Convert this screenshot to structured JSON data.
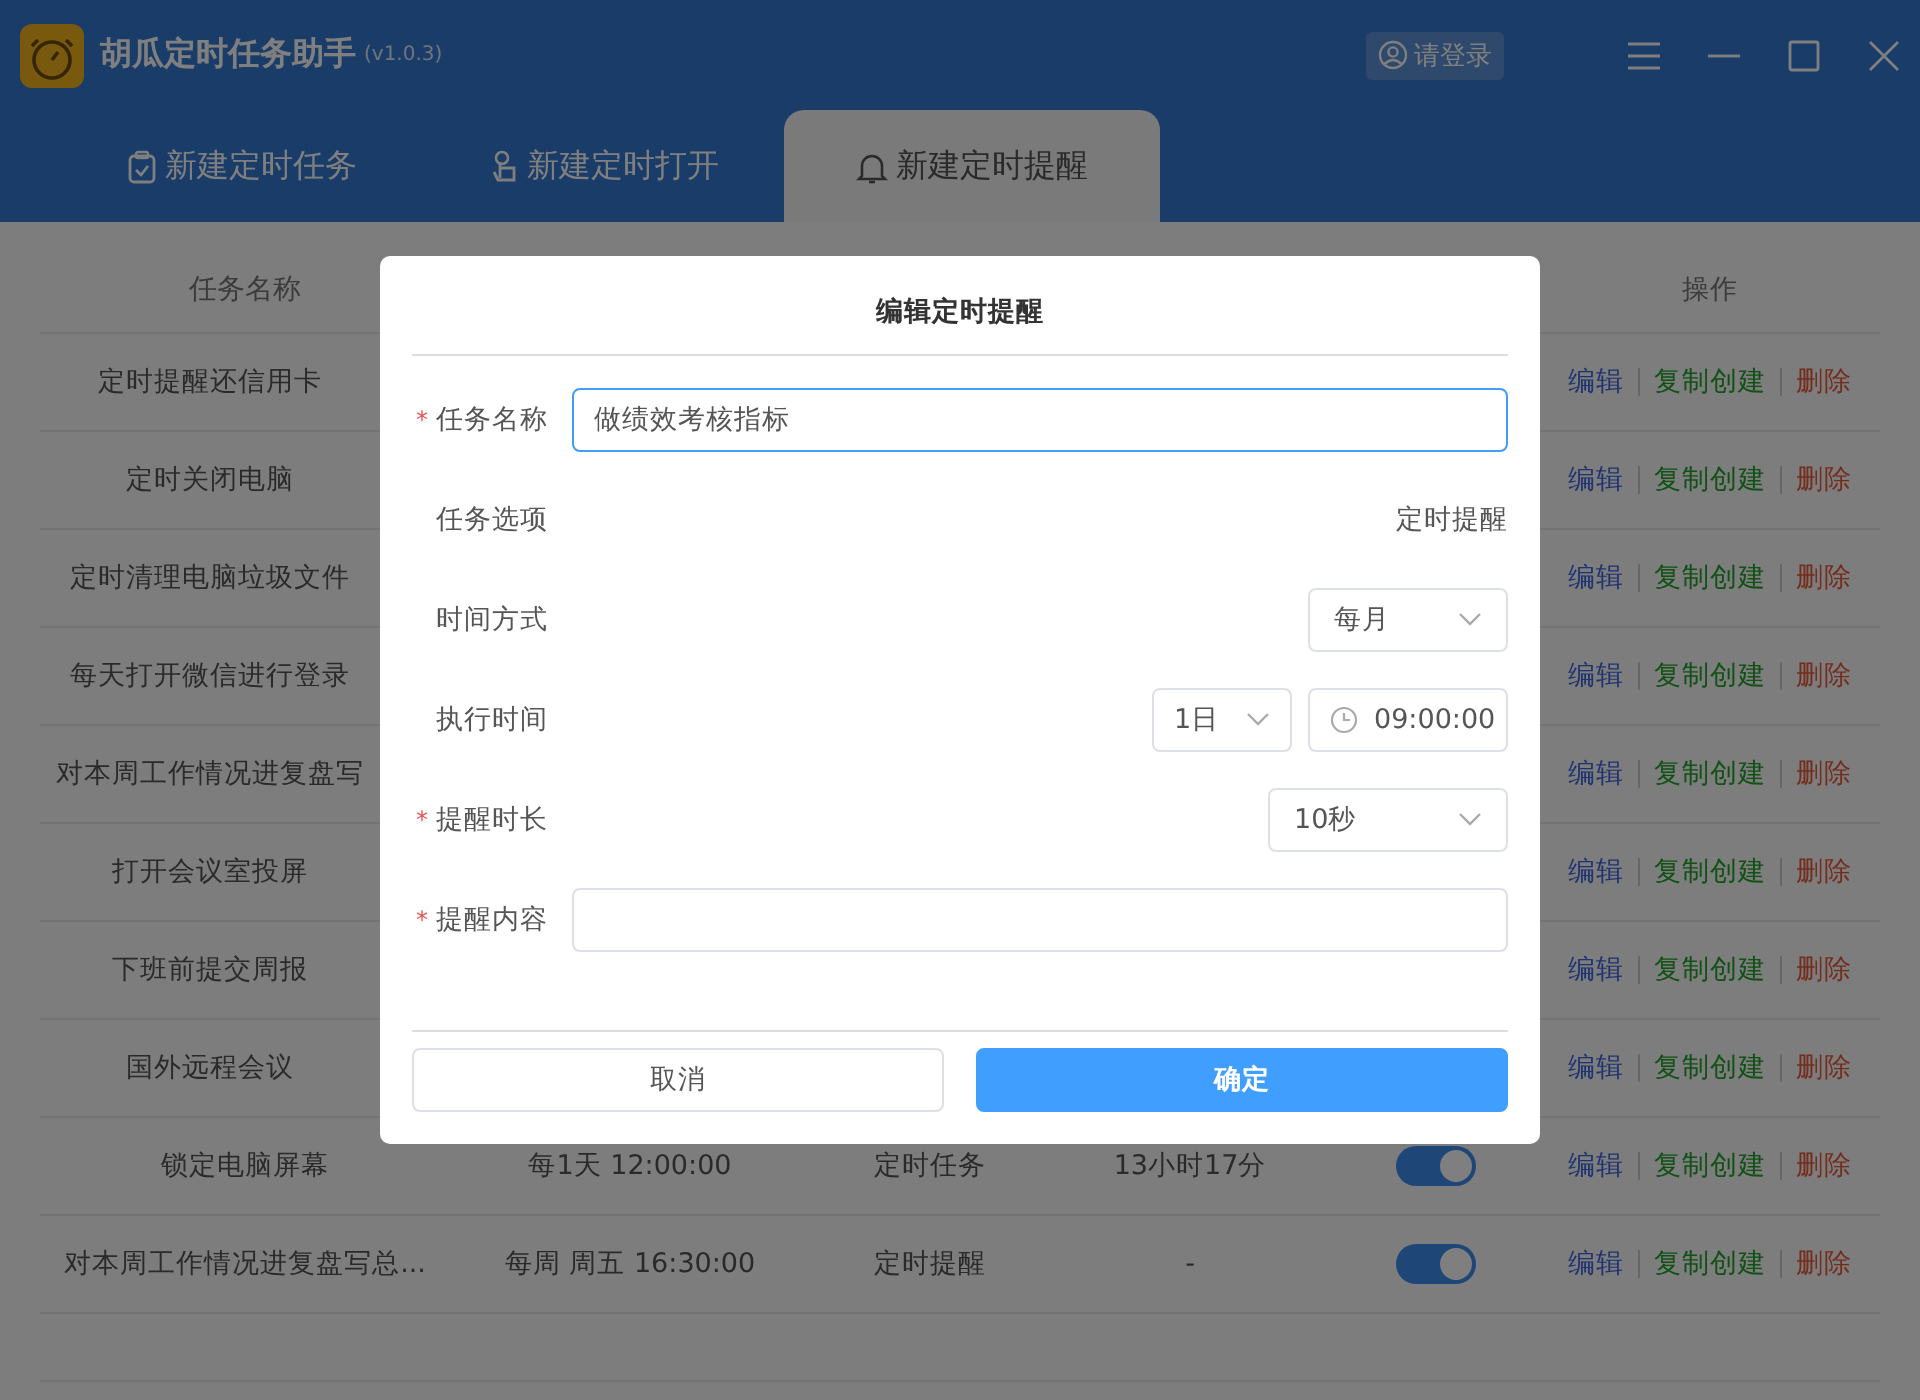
{
  "app": {
    "title": "胡瓜定时任务助手",
    "version": "(v1.0.3)",
    "login": "请登录"
  },
  "tabs": [
    {
      "label": "新建定时任务",
      "selected": false
    },
    {
      "label": "新建定时打开",
      "selected": false
    },
    {
      "label": "新建定时提醒",
      "selected": true
    }
  ],
  "table": {
    "name_header": "任务名称",
    "actions_header": "操作",
    "rows": [
      {
        "name": "定时提醒还信用卡",
        "actions": [
          "编辑",
          "复制创建",
          "删除"
        ]
      },
      {
        "name": "定时关闭电脑",
        "actions": [
          "编辑",
          "复制创建",
          "删除"
        ]
      },
      {
        "name": "定时清理电脑垃圾文件",
        "actions": [
          "编辑",
          "复制创建",
          "删除"
        ]
      },
      {
        "name": "每天打开微信进行登录",
        "actions": [
          "编辑",
          "复制创建",
          "删除"
        ]
      },
      {
        "name": "对本周工作情况进复盘写",
        "actions": [
          "编辑",
          "复制创建",
          "删除"
        ]
      },
      {
        "name": "打开会议室投屏",
        "actions": [
          "编辑",
          "复制创建",
          "删除"
        ]
      },
      {
        "name": "下班前提交周报",
        "actions": [
          "编辑",
          "复制创建",
          "删除"
        ]
      },
      {
        "name": "国外远程会议",
        "actions": [
          "编辑",
          "复制创建",
          "删除"
        ]
      },
      {
        "name": "锁定电脑屏幕",
        "schedule": "每1天 12:00:00",
        "type": "定时任务",
        "remaining": "13小时17分",
        "on": true,
        "actions": [
          "编辑",
          "复制创建",
          "删除"
        ]
      },
      {
        "name": "对本周工作情况进复盘写总...",
        "schedule": "每周 周五 16:30:00",
        "type": "定时提醒",
        "remaining": "-",
        "on": true,
        "actions": [
          "编辑",
          "复制创建",
          "删除"
        ]
      }
    ]
  },
  "dialog": {
    "title": "编辑定时提醒",
    "fields": [
      {
        "marker": "*",
        "label": "任务名称",
        "controls": [
          {
            "kind": "input",
            "value": "做绩效考核指标",
            "focused": true
          }
        ]
      },
      {
        "label": "任务选项",
        "controls": [
          {
            "kind": "text",
            "value": "定时提醒"
          }
        ]
      },
      {
        "label": "时间方式",
        "controls": [
          {
            "kind": "select",
            "value": "每月"
          }
        ]
      },
      {
        "label": "执行时间",
        "controls": [
          {
            "kind": "select",
            "value": "1日"
          },
          {
            "kind": "time",
            "value": "09:00:00"
          }
        ]
      },
      {
        "marker": "*",
        "label": "提醒时长",
        "controls": [
          {
            "kind": "select",
            "value": "10秒"
          }
        ]
      },
      {
        "marker": "*",
        "label": "提醒内容",
        "controls": [
          {
            "kind": "input",
            "focused": false
          }
        ]
      }
    ],
    "buttons": [
      {
        "label": "取消",
        "kind": "secondary"
      },
      {
        "label": "确定",
        "kind": "primary"
      }
    ]
  }
}
